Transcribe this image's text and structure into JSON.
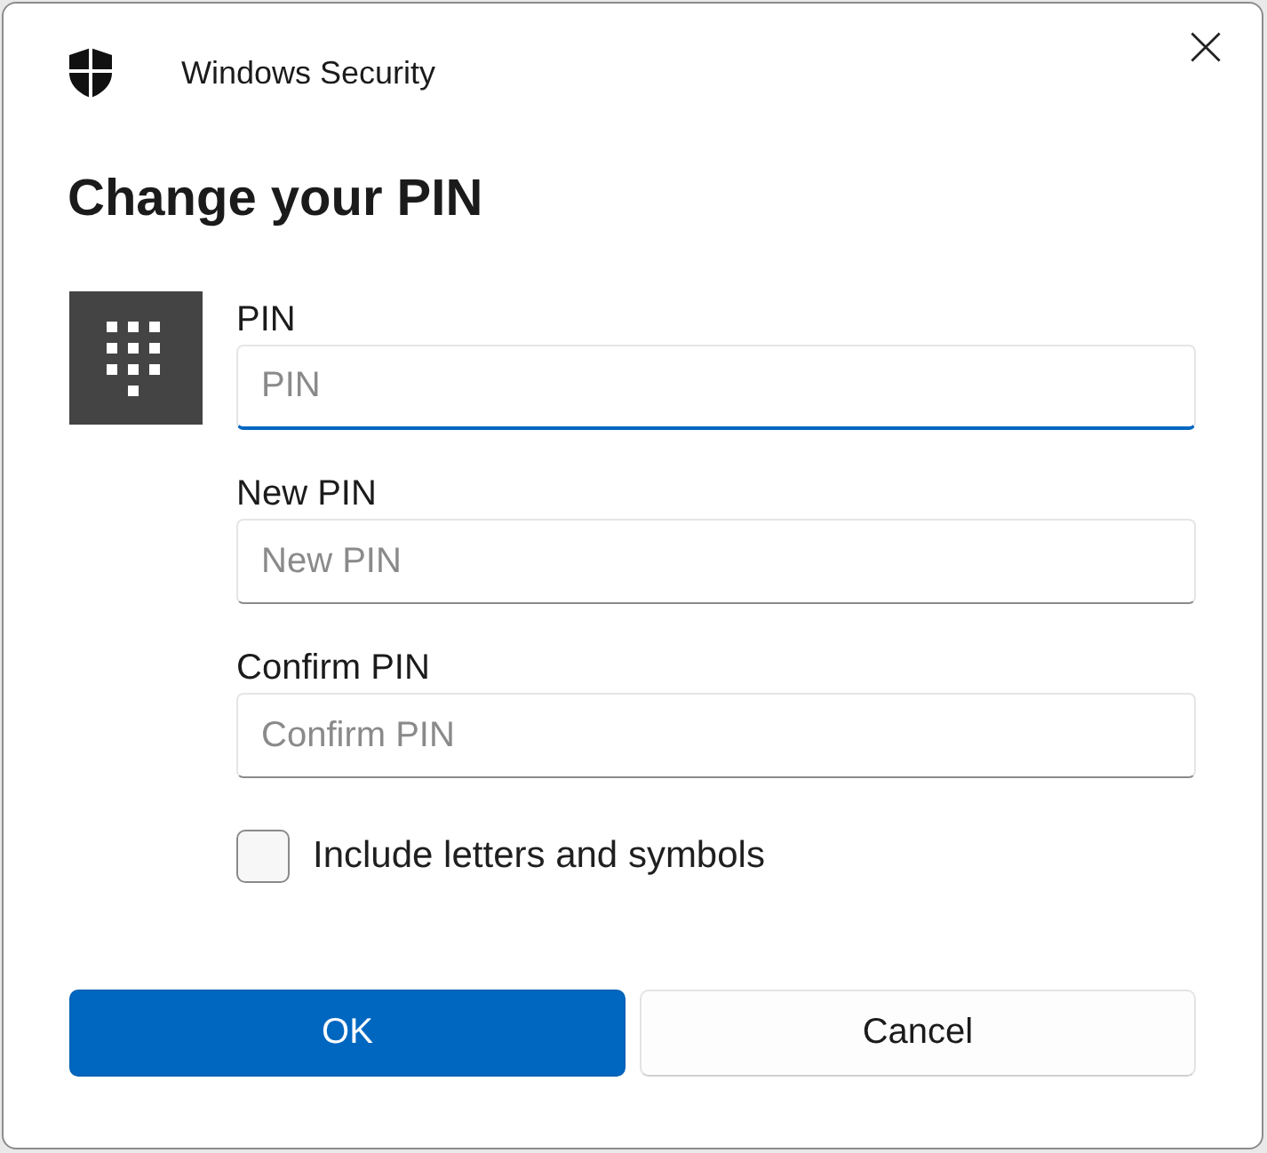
{
  "window": {
    "title": "Windows Security"
  },
  "heading": "Change your PIN",
  "fields": [
    {
      "label": "PIN",
      "placeholder": "PIN",
      "focused": true
    },
    {
      "label": "New PIN",
      "placeholder": "New PIN",
      "focused": false
    },
    {
      "label": "Confirm PIN",
      "placeholder": "Confirm PIN",
      "focused": false
    }
  ],
  "checkbox": {
    "label": "Include letters and symbols",
    "checked": false
  },
  "buttons": [
    {
      "label": "OK",
      "kind": "primary"
    },
    {
      "label": "Cancel",
      "kind": "secondary"
    }
  ]
}
